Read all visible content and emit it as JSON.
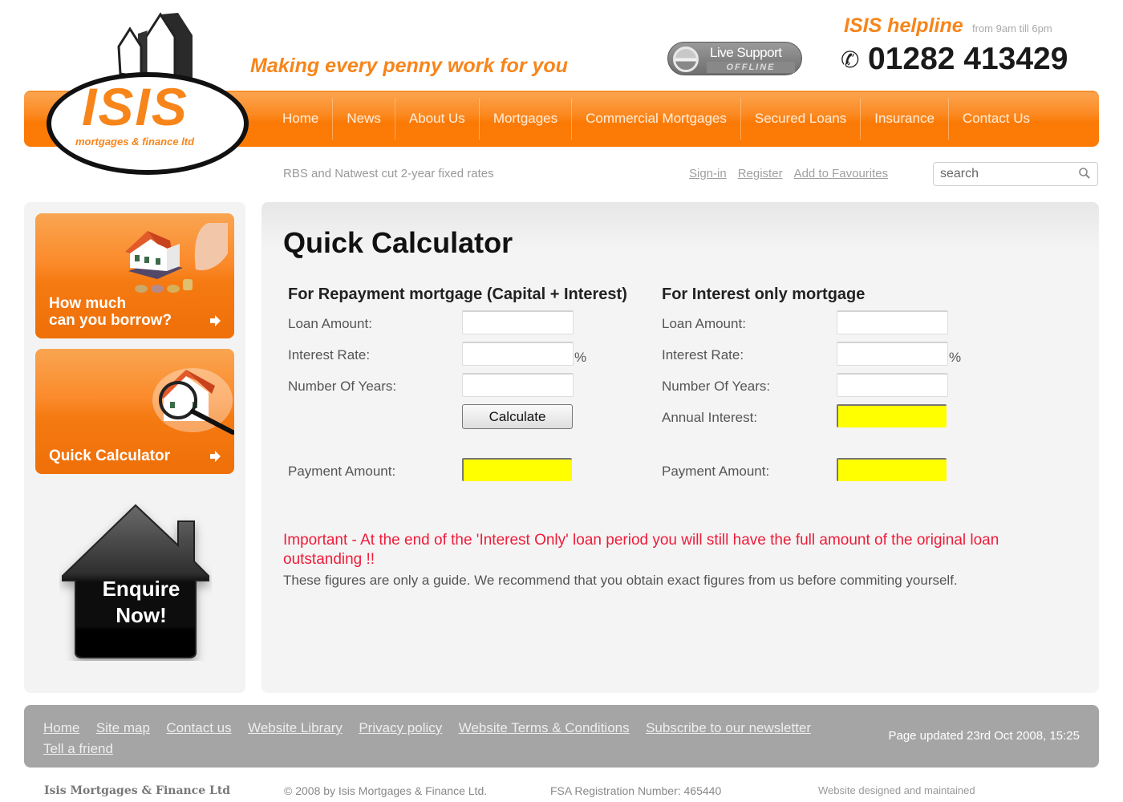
{
  "brand": {
    "logo_text": "ISIS",
    "logo_subtext": "mortgages & finance ltd",
    "tagline": "Making every penny work for you",
    "accent_color": "#f7851a"
  },
  "live_support": {
    "title": "Live Support",
    "status": "OFFLINE"
  },
  "helpline": {
    "title": "ISIS helpline",
    "hours": "from 9am till 6pm",
    "phone_icon": "phone-icon",
    "number": "01282 413429"
  },
  "nav": {
    "items": [
      {
        "label": "Home"
      },
      {
        "label": "News"
      },
      {
        "label": "About Us"
      },
      {
        "label": "Mortgages"
      },
      {
        "label": "Commercial Mortgages"
      },
      {
        "label": "Secured Loans"
      },
      {
        "label": "Insurance"
      },
      {
        "label": "Contact Us"
      }
    ]
  },
  "subheader": {
    "news_headline": "RBS and Natwest cut 2-year fixed rates",
    "links": [
      {
        "label": "Sign-in"
      },
      {
        "label": "Register"
      },
      {
        "label": "Add to Favourites"
      }
    ],
    "search": {
      "placeholder": "search",
      "value": "",
      "icon": "search-icon"
    }
  },
  "sidebar": {
    "promos": [
      {
        "label_line1": "How much",
        "label_line2": "can you borrow?",
        "icon": "arrow-right-icon"
      },
      {
        "label_line1": "Quick Calculator",
        "label_line2": "",
        "icon": "arrow-right-icon"
      }
    ],
    "enquire": {
      "line1": "Enquire",
      "line2": "Now!"
    }
  },
  "calculator": {
    "title": "Quick Calculator",
    "repayment": {
      "heading": "For Repayment mortgage (Capital + Interest)",
      "loan_amount_label": "Loan Amount:",
      "loan_amount_value": "",
      "interest_rate_label": "Interest Rate:",
      "interest_rate_value": "",
      "percent_sign": "%",
      "years_label": "Number Of Years:",
      "years_value": "",
      "calculate_label": "Calculate",
      "payment_label": "Payment Amount:",
      "payment_value": ""
    },
    "interest_only": {
      "heading": "For Interest only mortgage",
      "loan_amount_label": "Loan Amount:",
      "loan_amount_value": "",
      "interest_rate_label": "Interest Rate:",
      "interest_rate_value": "",
      "percent_sign": "%",
      "years_label": "Number Of Years:",
      "years_value": "",
      "annual_interest_label": "Annual Interest:",
      "annual_interest_value": "",
      "payment_label": "Payment Amount:",
      "payment_value": ""
    },
    "result_color": "#ffff00",
    "warning": "Important - At the end of the 'Interest Only' loan period you will still have the full amount of the original loan outstanding !!",
    "warning_color": "#ee1c3a",
    "guide": "These figures are only a guide. We recommend that you obtain exact figures from us before commiting yourself."
  },
  "footer": {
    "links": [
      {
        "label": "Home"
      },
      {
        "label": "Site map"
      },
      {
        "label": "Contact us"
      },
      {
        "label": "Website Library"
      },
      {
        "label": "Privacy policy"
      },
      {
        "label": "Website Terms & Conditions"
      },
      {
        "label": "Subscribe to our newsletter"
      },
      {
        "label": "Tell a friend"
      }
    ],
    "page_updated": "Page updated 23rd Oct 2008, 15:25",
    "company": "Isis Mortgages & Finance Ltd",
    "copyright": "© 2008 by Isis Mortgages & Finance Ltd.",
    "fsa": "FSA Registration Number: 465440",
    "designed_by": "Website designed and maintained"
  }
}
